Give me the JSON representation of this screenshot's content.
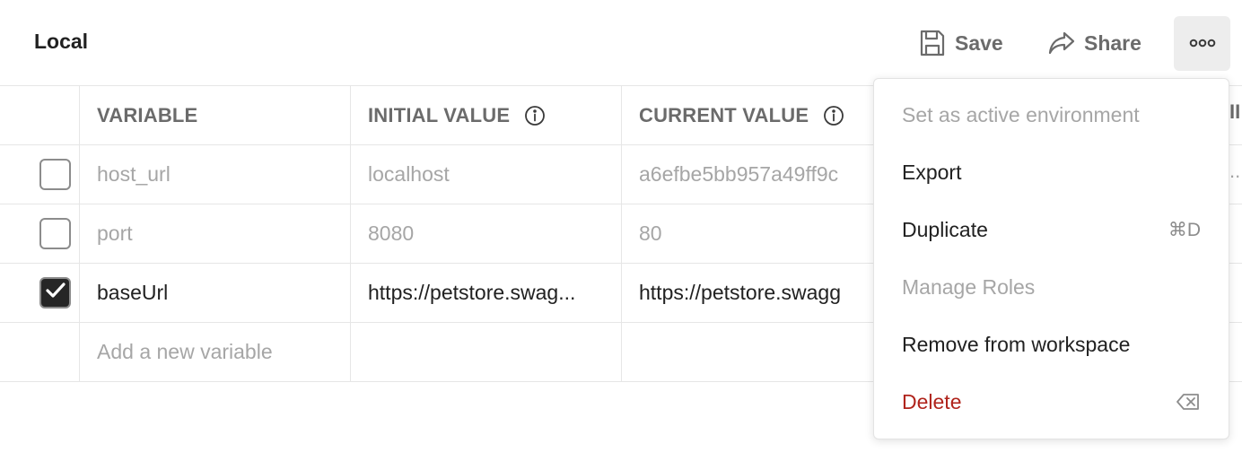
{
  "header": {
    "title": "Local",
    "save_label": "Save",
    "share_label": "Share",
    "more_icon": "more-horizontal-icon"
  },
  "table": {
    "columns": [
      "VARIABLE",
      "INITIAL VALUE",
      "CURRENT VALUE"
    ],
    "rows": [
      {
        "checked": false,
        "variable": "host_url",
        "initial": "localhost",
        "current": "a6efbe5bb957a49ff9c"
      },
      {
        "checked": false,
        "variable": "port",
        "initial": "8080",
        "current": "80"
      },
      {
        "checked": true,
        "variable": "baseUrl",
        "initial": "https://petstore.swag...",
        "current": "https://petstore.swagg"
      }
    ],
    "add_placeholder": "Add a new variable",
    "partial_column_glyph": "II",
    "partial_cell_glyph": "..."
  },
  "menu": {
    "items": [
      {
        "label": "Set as active environment",
        "state": "disabled",
        "shortcut": ""
      },
      {
        "label": "Export",
        "state": "normal",
        "shortcut": ""
      },
      {
        "label": "Duplicate",
        "state": "normal",
        "shortcut": "⌘D"
      },
      {
        "label": "Manage Roles",
        "state": "disabled",
        "shortcut": ""
      },
      {
        "label": "Remove from workspace",
        "state": "normal",
        "shortcut": ""
      },
      {
        "label": "Delete",
        "state": "danger",
        "shortcut": "⌫"
      }
    ]
  },
  "colors": {
    "danger": "#b0241c",
    "muted_text": "#a6a6a6",
    "header_text": "#6b6b6b",
    "checkbox_checked": "#262626"
  }
}
